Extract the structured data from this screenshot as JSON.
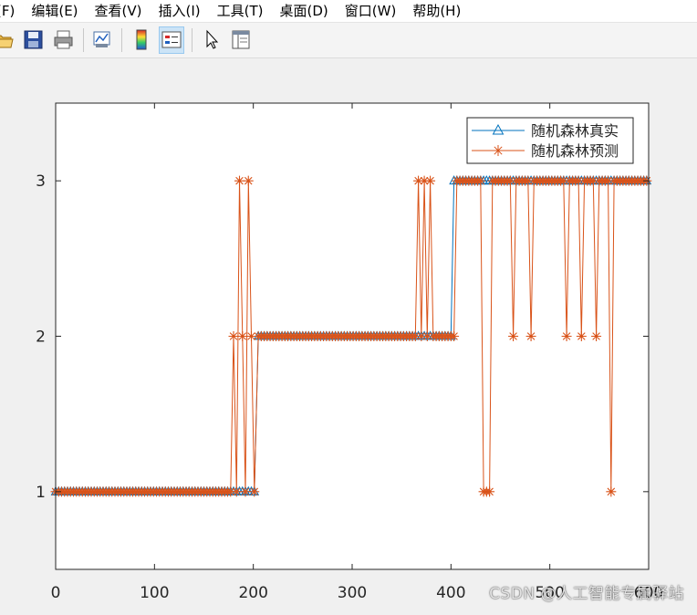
{
  "menu": [
    {
      "id": "file",
      "label": "(F)"
    },
    {
      "id": "edit",
      "label": "编辑(E)"
    },
    {
      "id": "view",
      "label": "查看(V)"
    },
    {
      "id": "insert",
      "label": "插入(I)"
    },
    {
      "id": "tools",
      "label": "工具(T)"
    },
    {
      "id": "desktop",
      "label": "桌面(D)"
    },
    {
      "id": "window",
      "label": "窗口(W)"
    },
    {
      "id": "help",
      "label": "帮助(H)"
    }
  ],
  "toolbar": {
    "buttons": [
      {
        "name": "open-file-icon",
        "icon": "folder"
      },
      {
        "name": "save-icon",
        "icon": "floppy-disk"
      },
      {
        "name": "print-icon",
        "icon": "printer"
      },
      {
        "name": "link-axes-icon",
        "icon": "link-plot"
      },
      {
        "name": "insert-colorbar-icon",
        "icon": "colorbar"
      },
      {
        "name": "insert-legend-icon",
        "icon": "legend",
        "active": true
      },
      {
        "name": "edit-plot-arrow-icon",
        "icon": "pointer-arrow"
      },
      {
        "name": "property-inspector-icon",
        "icon": "panel"
      }
    ]
  },
  "chart_data": {
    "type": "line",
    "xlim": [
      0,
      600
    ],
    "ylim": [
      0.5,
      3.5
    ],
    "xticks": [
      0,
      100,
      200,
      300,
      400,
      500,
      600
    ],
    "xtick_labels": [
      "0",
      "100",
      "200",
      "300",
      "400",
      "500",
      "600"
    ],
    "yticks": [
      1,
      2,
      3
    ],
    "ytick_labels": [
      "1",
      "2",
      "3"
    ],
    "grid": false,
    "legend_position": "top-right",
    "title": "",
    "xlabel": "",
    "ylabel": "",
    "series": [
      {
        "name": "随机森林真实",
        "marker": "triangle",
        "color": "#0072bd",
        "segments": [
          {
            "x_start": 0,
            "x_end": 202,
            "value": 1
          },
          {
            "x_start": 202,
            "x_end": 400,
            "value": 2
          },
          {
            "x_start": 400,
            "x_end": 600,
            "value": 3
          }
        ],
        "step": 3
      },
      {
        "name": "随机森林预测",
        "marker": "asterisk",
        "color": "#d95319",
        "base": [
          {
            "x_start": 0,
            "x_end": 202,
            "value": 1
          },
          {
            "x_start": 202,
            "x_end": 400,
            "value": 2
          },
          {
            "x_start": 400,
            "x_end": 600,
            "value": 3
          }
        ],
        "step": 3,
        "exceptions": [
          {
            "x": 181,
            "y": 2
          },
          {
            "x": 186,
            "y": 3
          },
          {
            "x": 190,
            "y": 2
          },
          {
            "x": 194,
            "y": 3
          },
          {
            "x": 198,
            "y": 2
          },
          {
            "x": 366,
            "y": 3
          },
          {
            "x": 374,
            "y": 3
          },
          {
            "x": 378,
            "y": 3
          },
          {
            "x": 404,
            "y": 2
          },
          {
            "x": 432,
            "y": 1
          },
          {
            "x": 435,
            "y": 1
          },
          {
            "x": 438,
            "y": 1
          },
          {
            "x": 464,
            "y": 2
          },
          {
            "x": 481,
            "y": 2
          },
          {
            "x": 518,
            "y": 2
          },
          {
            "x": 531,
            "y": 2
          },
          {
            "x": 546,
            "y": 2
          },
          {
            "x": 563,
            "y": 1
          }
        ]
      }
    ]
  },
  "watermark": "CSDN @人工智能专属驿站"
}
